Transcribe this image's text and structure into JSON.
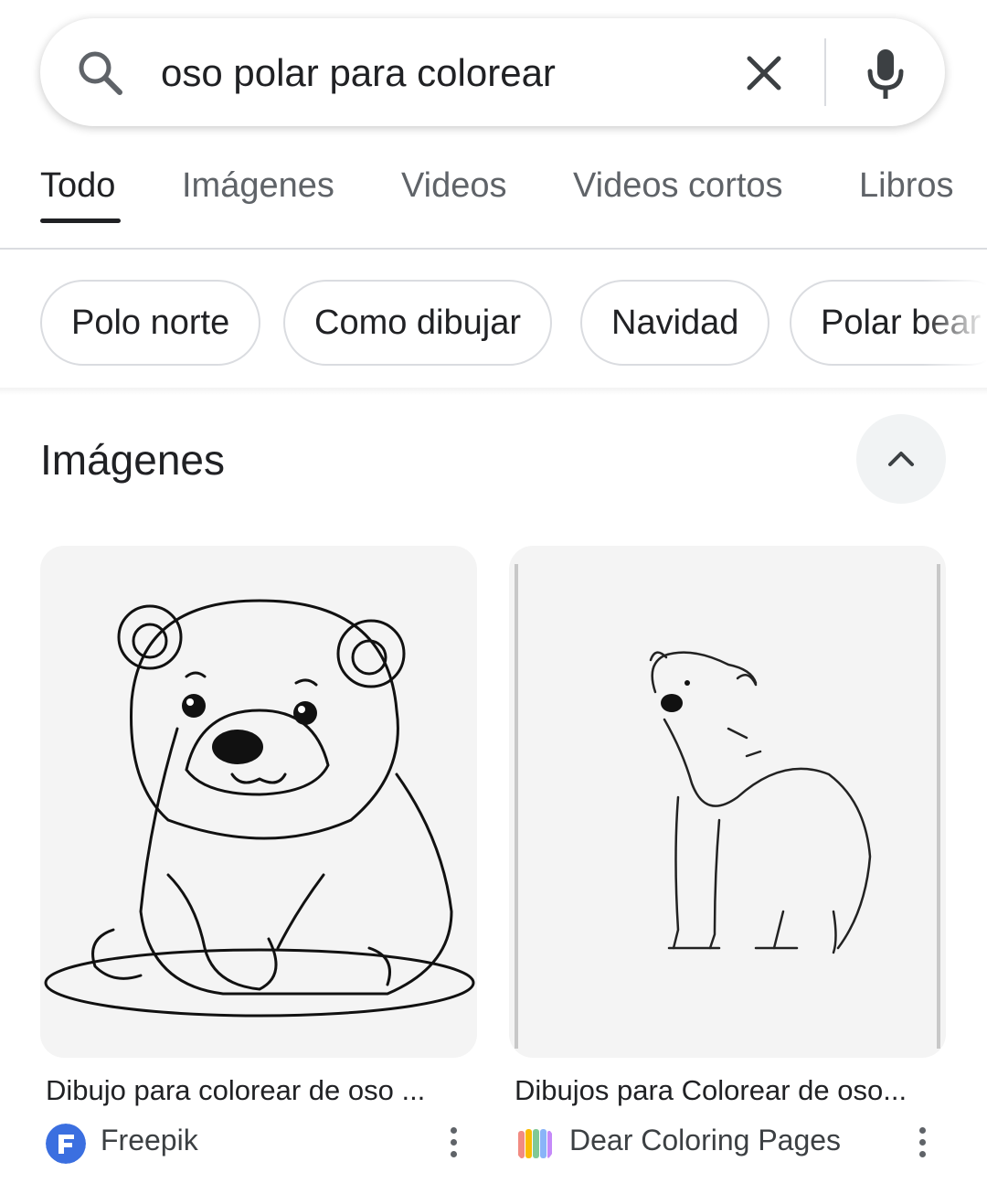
{
  "search": {
    "query": "oso polar para colorear",
    "icons": {
      "search": "search-icon",
      "clear": "close-icon",
      "voice": "microphone-icon"
    }
  },
  "tabs": [
    {
      "label": "Todo",
      "active": true
    },
    {
      "label": "Imágenes",
      "active": false
    },
    {
      "label": "Videos",
      "active": false
    },
    {
      "label": "Videos cortos",
      "active": false
    },
    {
      "label": "Libros",
      "active": false
    }
  ],
  "chips": [
    "Polo norte",
    "Como dibujar",
    "Navidad",
    "Polar bear"
  ],
  "section": {
    "title": "Imágenes",
    "collapse_icon": "chevron-up-icon"
  },
  "results": [
    {
      "title": "Dibujo para colorear de oso ...",
      "source": "Freepik",
      "favicon_color": "#3b6fe0"
    },
    {
      "title": "Dibujos para Colorear de oso...",
      "source": "Dear Coloring Pages",
      "favicon_color": "#e8a0a0"
    }
  ],
  "colors": {
    "accent": "#202124",
    "muted": "#5f6368",
    "border": "#dadce0"
  }
}
